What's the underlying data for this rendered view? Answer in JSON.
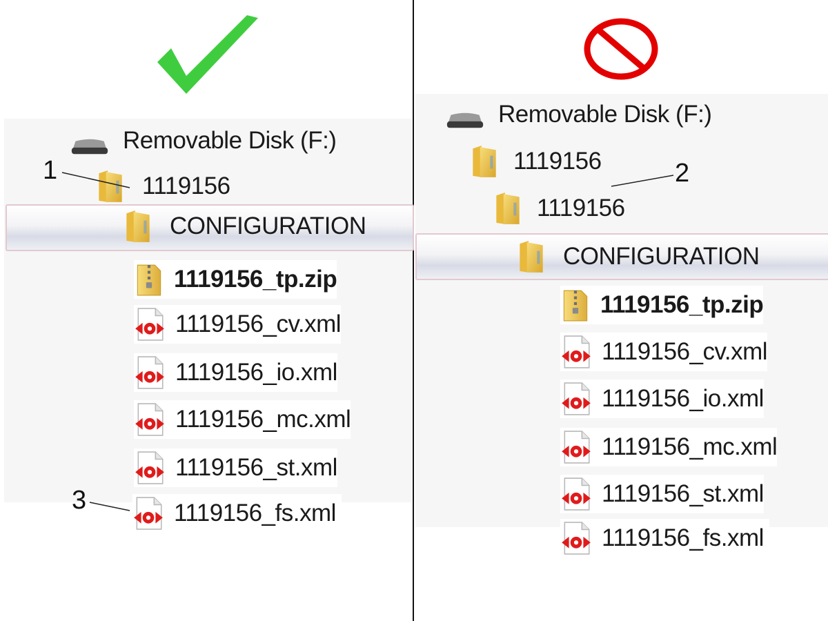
{
  "left_panel": {
    "drive_label": "Removable Disk (F:)",
    "folder_1": "1119156",
    "folder_config": "CONFIGURATION",
    "files": [
      "1119156_tp.zip",
      "1119156_cv.xml",
      "1119156_io.xml",
      "1119156_mc.xml",
      "1119156_st.xml",
      "1119156_fs.xml"
    ],
    "callout_folder": "1",
    "callout_file": "3"
  },
  "right_panel": {
    "drive_label": "Removable Disk (F:)",
    "folder_1": "1119156",
    "folder_2": "1119156",
    "folder_config": "CONFIGURATION",
    "files": [
      "1119156_tp.zip",
      "1119156_cv.xml",
      "1119156_io.xml",
      "1119156_mc.xml",
      "1119156_st.xml",
      "1119156_fs.xml"
    ],
    "callout_folder": "2"
  },
  "indicators": {
    "correct_icon": "check-mark-icon",
    "incorrect_icon": "prohibited-icon"
  },
  "colors": {
    "check": "#3fcd3f",
    "prohibited": "#e30000",
    "xml_icon": "#e01b1b",
    "folder": "#f0c24a",
    "selection_border": "#e2c9cf"
  },
  "icons": {
    "drive": "removable-drive-icon",
    "folder": "folder-icon",
    "zip": "zip-archive-icon",
    "xml": "xml-file-icon"
  }
}
